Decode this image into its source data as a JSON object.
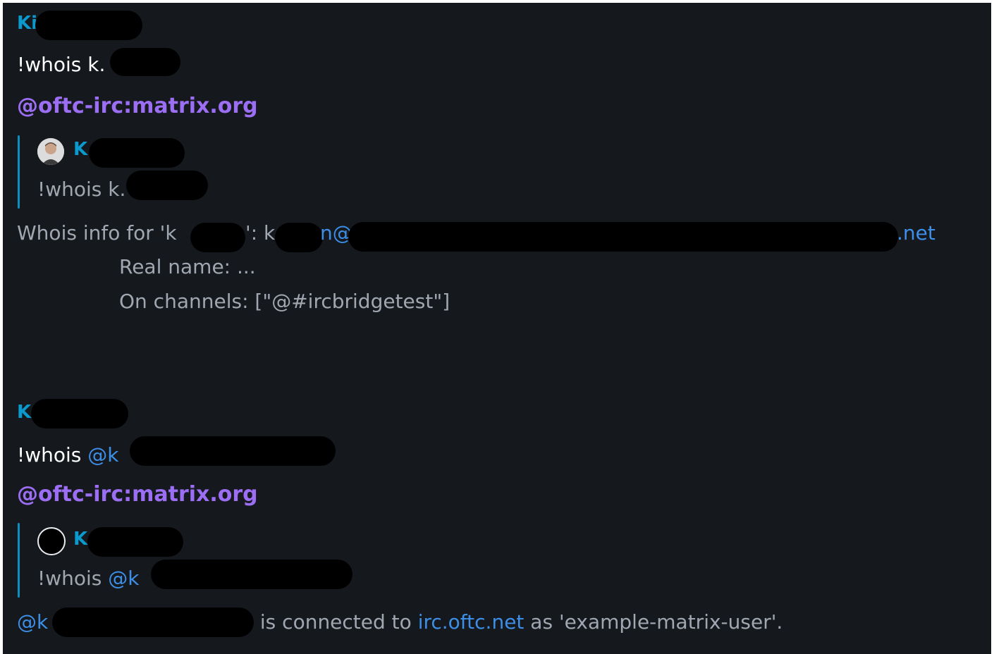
{
  "messages": [
    {
      "sender": "Ki",
      "command_prefix": "!whois k.",
      "bot": "@oftc-irc:matrix.org",
      "reply": {
        "sender": "K",
        "text": "!whois k."
      },
      "response": {
        "line1_prefix": "Whois info for 'k",
        "line1_mid": "': k",
        "line1_at": "n@",
        "line1_suffix": ".net",
        "real_name": "Real name: ...",
        "channels": "On channels: [\"@#ircbridgetest\"]"
      }
    },
    {
      "sender": "K",
      "command_prefix": "!whois ",
      "command_mention": "@k",
      "bot": "@oftc-irc:matrix.org",
      "reply": {
        "sender": "K",
        "text_prefix": "!whois ",
        "text_mention": "@k"
      },
      "response": {
        "mention": "@k",
        "connected_text": " is connected to ",
        "server": "irc.oftc.net",
        "as_text": " as 'example-matrix-user'."
      }
    }
  ],
  "colors": {
    "background": "#15191e",
    "sender": "#0a9ace",
    "bot": "#9b6ef3",
    "link": "#3d8ee6",
    "muted": "#a0a7b1"
  }
}
